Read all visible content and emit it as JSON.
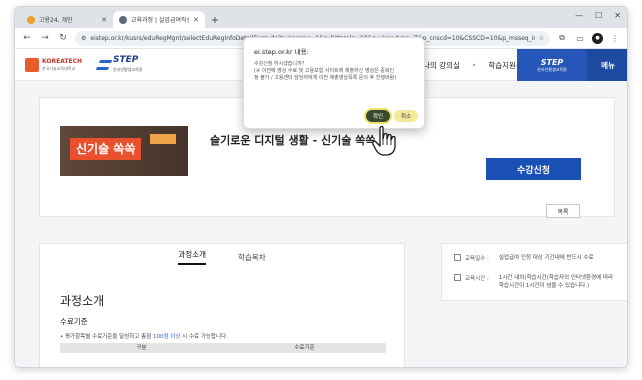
{
  "browser": {
    "tabs": [
      {
        "title": "고용24, 개인",
        "active": false,
        "favicon_color": "#e8a22a"
      },
      {
        "title": "교육과정 | 실업급여직승자",
        "active": true,
        "favicon_color": "#5a6a7a"
      }
    ],
    "new_tab_label": "+",
    "url": "eistep.or.kr/kusrs/eduRegMgnt/selectEduRegInfoDetailForm.do?p_pageno=1&p_listscale=12&p_view_type=T&p_cnscd=10&CSSCD=10&p_msseq_id=&p_msnm=&p_orgn_id=&..."
  },
  "site": {
    "logo_korea_tech": "KOREATECH",
    "logo_korea_tech_sub": "한국기술교육대학교",
    "logo_step": "STEP",
    "logo_step_sub": "온라인평생교육원",
    "nav": [
      "나의 강의실",
      "학습지원센터"
    ],
    "promo_title": "STEP",
    "promo_sub": "온라인평생교육원",
    "menu_label": "메뉴"
  },
  "course": {
    "thumbnail_text": "신기술 쏙쏙",
    "title": "슬기로운 디지털 생활 - 신기술 쏙쏙",
    "enroll_button": "수강신청",
    "list_button": "목록"
  },
  "content_tabs": [
    "과정소개",
    "학습목차"
  ],
  "intro": {
    "title": "과정소개",
    "subtitle": "수료기준",
    "note_prefix": "• 평가항목별 수료기준을 달성하고 총점 ",
    "note_highlight": "100점 이상",
    "note_suffix": " 시 수료 가능합니다.",
    "table_headers": [
      "구분",
      "수료기준"
    ]
  },
  "info": [
    {
      "label": "교육일수 :",
      "value": "실업급여 인정 대상 기간내에 반드시 수료"
    },
    {
      "label": "교육시간 :",
      "value": "1시간 내외(학습시간(학습자의 인터넷환경에 따라\n학습시간이 1시간이 넘을 수 있습니다.)"
    }
  ],
  "dialog": {
    "origin": "ei.step.or.kr 내용:",
    "message": "수강신청 하시겠습니까?\n(※ 이전에 영상 수료 및 고용보험 사이트에 제출하신 영상은 중복인\n정 불가 / 고용센터 담당자에게 이전 제출영상목록 문의 후 진행바람)",
    "ok_label": "확인",
    "cancel_label": "취소"
  },
  "colors": {
    "primary_blue": "#1a4fb5",
    "dialog_ok": "#3a4a2e",
    "dialog_cancel": "#f3e99a",
    "highlight": "#f1e36a",
    "thumbnail_accent": "#e8502e"
  }
}
